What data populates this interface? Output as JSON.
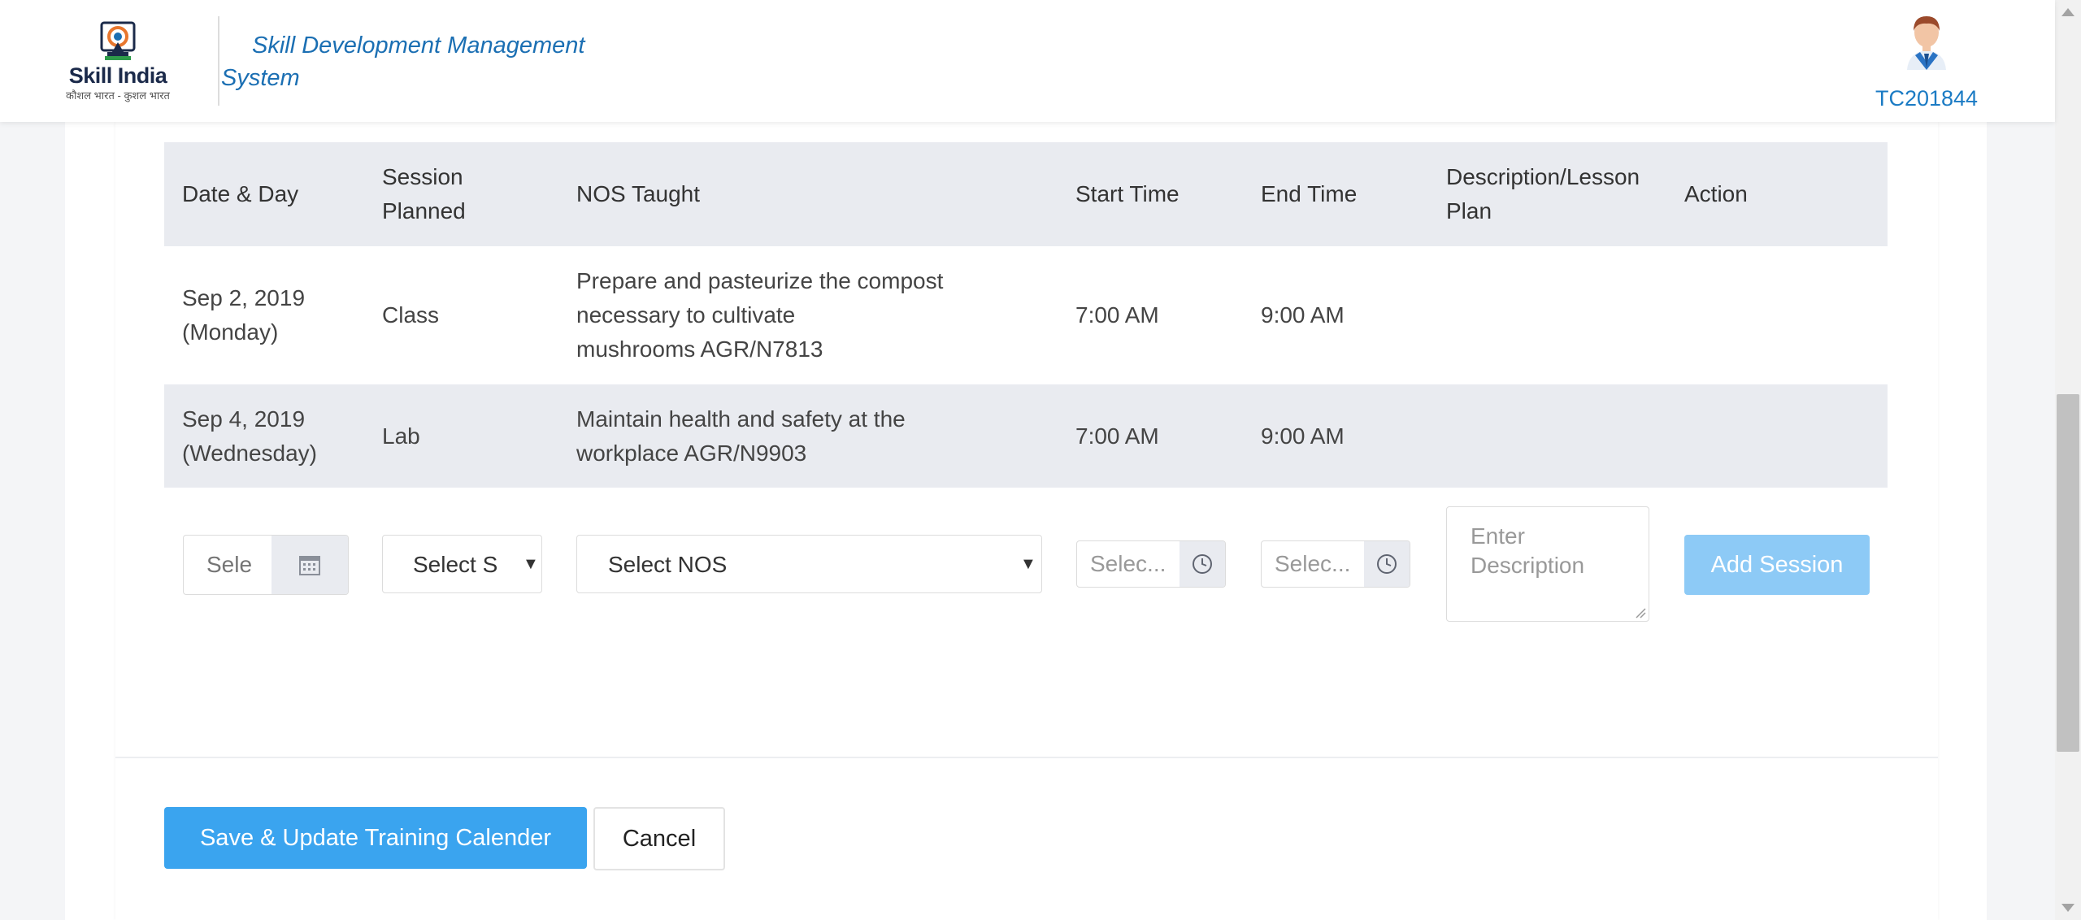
{
  "header": {
    "logo_title": "Skill India",
    "logo_tagline": "कौशल भारत - कुशल भारत",
    "app_title": "Skill Development Management System",
    "user_id": "TC201844",
    "avatar_icon": "user-avatar-icon"
  },
  "table": {
    "columns": {
      "date_day": "Date & Day",
      "session_planned": "Session Planned",
      "nos_taught": "NOS Taught",
      "start_time": "Start Time",
      "end_time": "End Time",
      "description": "Description/Lesson Plan",
      "action": "Action"
    },
    "rows": [
      {
        "date": "Sep 2, 2019",
        "day": "(Monday)",
        "session": "Class",
        "nos_line1": "Prepare and pasteurize the compost",
        "nos_line2": "necessary to cultivate",
        "nos_line3": "mushrooms AGR/N7813",
        "start": "7:00 AM",
        "end": "9:00 AM",
        "description": "",
        "action": ""
      },
      {
        "date": "Sep 4, 2019",
        "day": "(Wednesday)",
        "session": "Lab",
        "nos_line1": "Maintain health and safety at the",
        "nos_line2": "workplace AGR/N9903",
        "start": "7:00 AM",
        "end": "9:00 AM",
        "description": "",
        "action": ""
      }
    ]
  },
  "form": {
    "date_placeholder": "Sele",
    "session_select": "Select S",
    "nos_select": "Select NOS",
    "start_placeholder": "Selec...",
    "end_placeholder": "Selec...",
    "description_placeholder": "Enter Description",
    "add_session_label": "Add Session",
    "calendar_icon": "calendar-icon",
    "clock_icon": "clock-icon"
  },
  "footer": {
    "save_label": "Save & Update Training Calender",
    "cancel_label": "Cancel"
  },
  "colors": {
    "brand_blue": "#1b6fb3",
    "primary_button": "#3aa4ef",
    "disabled_button": "#8dcaf6",
    "table_header_bg": "#e9ebf0"
  }
}
